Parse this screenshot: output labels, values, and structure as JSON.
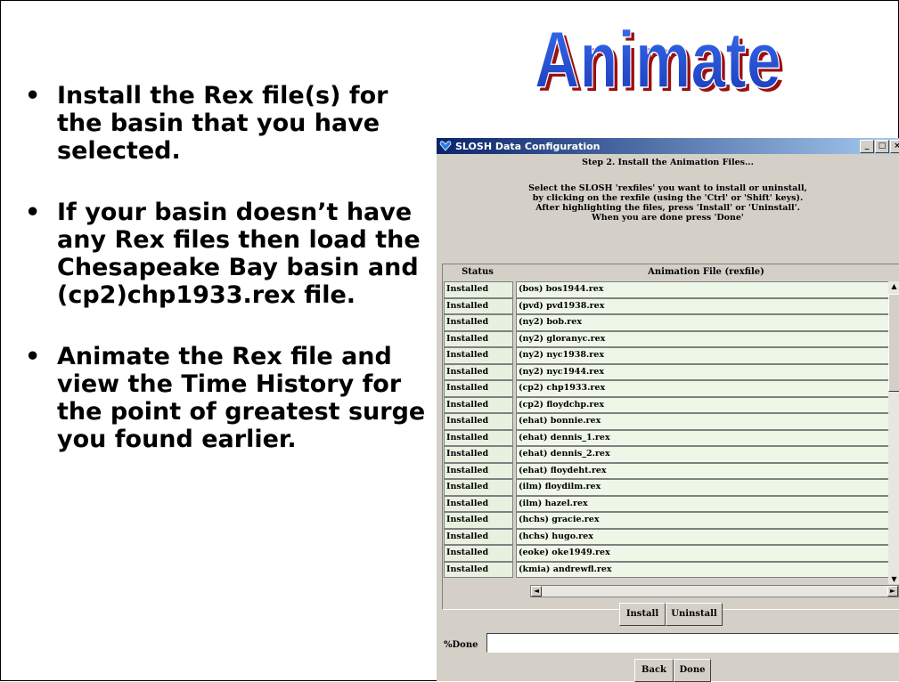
{
  "slide": {
    "title": "Animate",
    "bullets": [
      "Install the Rex file(s) for the basin that you have selected.",
      "If your basin doesn’t have any Rex files then load the Chesapeake Bay basin and (cp2)chp1933.rex file.",
      "Animate the Rex file and view the Time History for the point of greatest surge you found earlier."
    ],
    "bullet_glyph": "•",
    "title_color": "#1f4fd8"
  },
  "dialog": {
    "window_title": "SLOSH Data Configuration",
    "window_buttons": [
      "_",
      "□",
      "×"
    ],
    "step_text": "Step 2. Install the Animation Files...",
    "instructions": [
      "Select the SLOSH 'rexfiles' you want to install or uninstall,",
      "by clicking on the rexfile (using the 'Ctrl' or 'Shift' keys).",
      "After highlighting the files, press 'Install' or 'Uninstall'.",
      "When you are done press 'Done'"
    ],
    "columns": [
      "Status",
      "Animation File (rexfile)"
    ],
    "rows": [
      {
        "status": "Installed",
        "file": "(bos) bos1944.rex"
      },
      {
        "status": "Installed",
        "file": "(pvd) pvd1938.rex"
      },
      {
        "status": "Installed",
        "file": "(ny2) bob.rex"
      },
      {
        "status": "Installed",
        "file": "(ny2) gloranyc.rex"
      },
      {
        "status": "Installed",
        "file": "(ny2) nyc1938.rex"
      },
      {
        "status": "Installed",
        "file": "(ny2) nyc1944.rex"
      },
      {
        "status": "Installed",
        "file": "(cp2) chp1933.rex"
      },
      {
        "status": "Installed",
        "file": "(cp2) floydchp.rex"
      },
      {
        "status": "Installed",
        "file": "(ehat) bonnie.rex"
      },
      {
        "status": "Installed",
        "file": "(ehat) dennis_1.rex"
      },
      {
        "status": "Installed",
        "file": "(ehat) dennis_2.rex"
      },
      {
        "status": "Installed",
        "file": "(ehat) floydeht.rex"
      },
      {
        "status": "Installed",
        "file": "(ilm) floydilm.rex"
      },
      {
        "status": "Installed",
        "file": "(ilm) hazel.rex"
      },
      {
        "status": "Installed",
        "file": "(hchs) gracie.rex"
      },
      {
        "status": "Installed",
        "file": "(hchs) hugo.rex"
      },
      {
        "status": "Installed",
        "file": "(eoke) oke1949.rex"
      },
      {
        "status": "Installed",
        "file": "(kmia) andrewfl.rex"
      }
    ],
    "install_label": "Install",
    "uninstall_label": "Uninstall",
    "percent_label": "%Done",
    "percent_value": "",
    "back_label": "Back",
    "done_label": "Done"
  }
}
